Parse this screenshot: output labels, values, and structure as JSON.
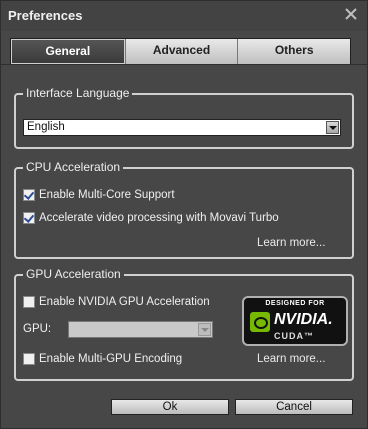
{
  "window": {
    "title": "Preferences"
  },
  "tabs": [
    {
      "label": "General",
      "active": true
    },
    {
      "label": "Advanced",
      "active": false
    },
    {
      "label": "Others",
      "active": false
    }
  ],
  "interface_language": {
    "legend": "Interface Language",
    "selected": "English"
  },
  "cpu": {
    "legend": "CPU Acceleration",
    "multicore": {
      "label": "Enable Multi-Core Support",
      "checked": true
    },
    "turbo": {
      "label": "Accelerate video processing with Movavi Turbo",
      "checked": true
    },
    "learn_more": "Learn more..."
  },
  "gpu": {
    "legend": "GPU Acceleration",
    "nvidia": {
      "label": "Enable NVIDIA GPU Acceleration",
      "checked": false
    },
    "gpu_label": "GPU:",
    "gpu_value": "",
    "multigpu": {
      "label": "Enable Multi-GPU Encoding",
      "checked": false
    },
    "learn_more": "Learn more...",
    "badge": {
      "top": "DESIGNED FOR",
      "name": "NVIDIA.",
      "sub": "CUDA™"
    }
  },
  "buttons": {
    "ok": "Ok",
    "cancel": "Cancel"
  },
  "colors": {
    "nvidia_green": "#76b900",
    "window_bg": "#474747"
  }
}
